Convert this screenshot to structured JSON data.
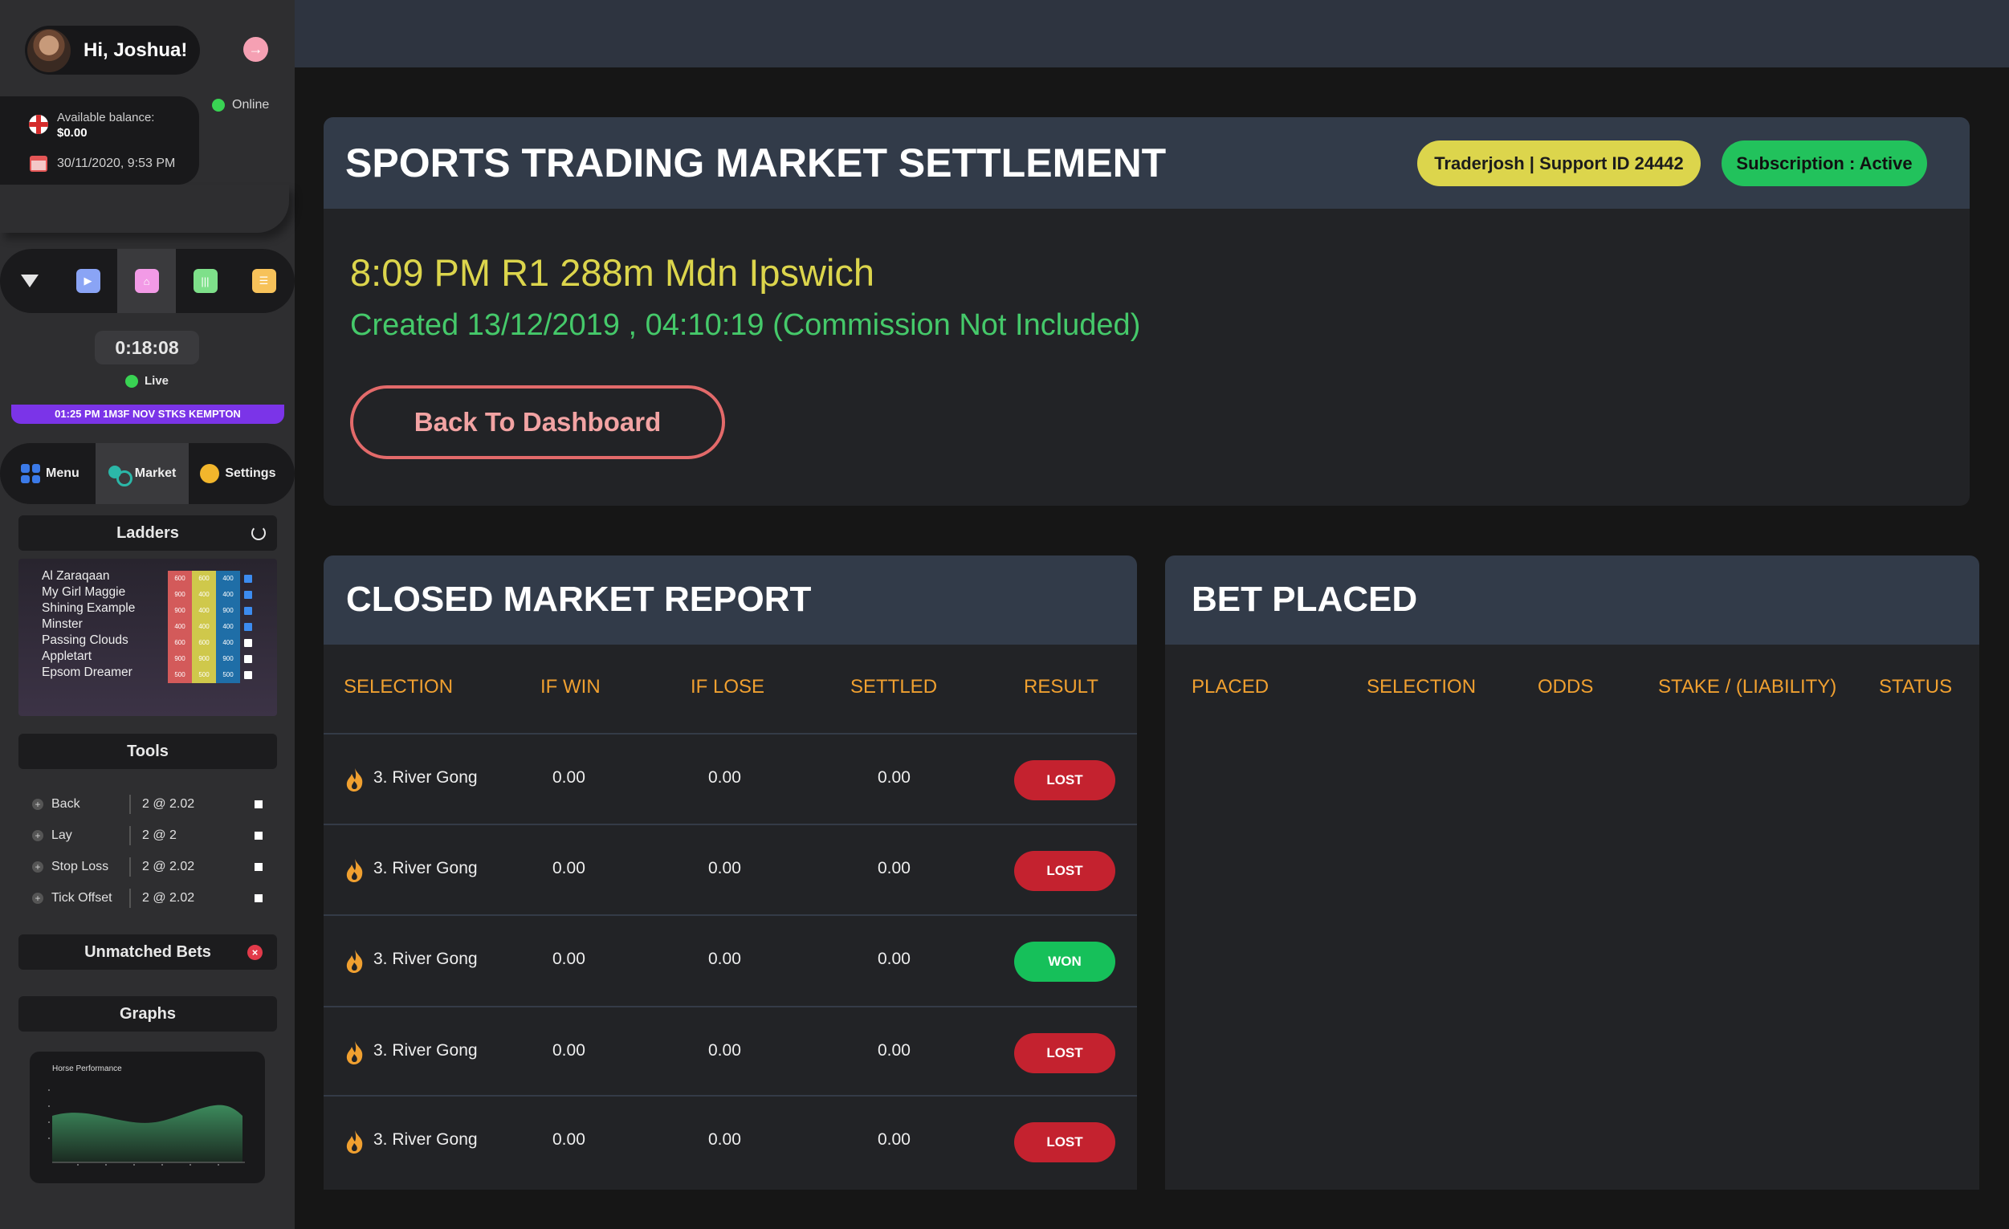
{
  "sidebar": {
    "greeting": "Hi, Joshua!",
    "status": "Online",
    "balance_label": "Available balance:",
    "balance_value": "$0.00",
    "datetime": "30/11/2020, 9:53 PM",
    "timer": "0:18:08",
    "live_label": "Live",
    "ticker": "01:25 PM 1M3F NOV STKS KEMPTON",
    "nav": {
      "menu": "Menu",
      "market": "Market",
      "settings": "Settings"
    },
    "ladders_title": "Ladders",
    "ladders": [
      {
        "name": "Al Zaraqaan",
        "v1": "600",
        "v2": "600",
        "v3": "400",
        "checked": true
      },
      {
        "name": "My Girl Maggie",
        "v1": "900",
        "v2": "400",
        "v3": "400",
        "checked": true
      },
      {
        "name": "Shining Example",
        "v1": "900",
        "v2": "400",
        "v3": "900",
        "checked": true
      },
      {
        "name": "Minster",
        "v1": "400",
        "v2": "400",
        "v3": "400",
        "checked": true
      },
      {
        "name": "Passing Clouds",
        "v1": "600",
        "v2": "600",
        "v3": "400",
        "checked": false
      },
      {
        "name": "Appletart",
        "v1": "900",
        "v2": "900",
        "v3": "900",
        "checked": false
      },
      {
        "name": "Epsom Dreamer",
        "v1": "500",
        "v2": "500",
        "v3": "500",
        "checked": false
      }
    ],
    "tools_title": "Tools",
    "tools": [
      {
        "label": "Back",
        "value": "2 @ 2.02"
      },
      {
        "label": "Lay",
        "value": "2 @ 2"
      },
      {
        "label": "Stop Loss",
        "value": "2 @ 2.02"
      },
      {
        "label": "Tick Offset",
        "value": "2 @ 2.02"
      }
    ],
    "unmatched_title": "Unmatched Bets",
    "graphs_title": "Graphs",
    "graph_caption": "Horse Performance"
  },
  "settlement": {
    "title": "SPORTS TRADING MARKET SETTLEMENT",
    "user_pill": "Traderjosh | Support ID 24442",
    "subscription_pill": "Subscription : Active",
    "race": "8:09 PM R1 288m Mdn Ipswich",
    "created": "Created 13/12/2019 , 04:10:19 (Commission Not Included)",
    "back_button": "Back To Dashboard"
  },
  "report": {
    "title": "CLOSED MARKET REPORT",
    "columns": [
      "SELECTION",
      "IF WIN",
      "IF LOSE",
      "SETTLED",
      "RESULT"
    ],
    "rows": [
      {
        "selection": "3. River Gong",
        "if_win": "0.00",
        "if_lose": "0.00",
        "settled": "0.00",
        "result": "LOST"
      },
      {
        "selection": "3. River Gong",
        "if_win": "0.00",
        "if_lose": "0.00",
        "settled": "0.00",
        "result": "LOST"
      },
      {
        "selection": "3. River Gong",
        "if_win": "0.00",
        "if_lose": "0.00",
        "settled": "0.00",
        "result": "WON"
      },
      {
        "selection": "3. River Gong",
        "if_win": "0.00",
        "if_lose": "0.00",
        "settled": "0.00",
        "result": "LOST"
      },
      {
        "selection": "3. River Gong",
        "if_win": "0.00",
        "if_lose": "0.00",
        "settled": "0.00",
        "result": "LOST"
      }
    ]
  },
  "bets": {
    "title": "BET PLACED",
    "columns": [
      "PLACED",
      "SELECTION",
      "ODDS",
      "STAKE / (LIABILITY)",
      "STATUS"
    ]
  },
  "colors": {
    "accent_yellow": "#dcd54c",
    "accent_green": "#22c25c",
    "header_orange": "#f0a030",
    "lost_red": "#c4222f",
    "won_green": "#16c05a"
  }
}
